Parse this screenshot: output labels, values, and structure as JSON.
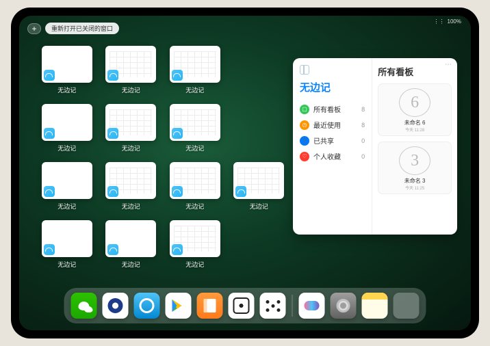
{
  "topbar": {
    "plus_label": "+",
    "reopen_label": "重新打开已关闭的窗口"
  },
  "statusbar": {
    "battery": "100%"
  },
  "grid": {
    "app_label": "无边记"
  },
  "panel": {
    "left_title": "无边记",
    "right_title": "所有看板",
    "filters": [
      {
        "label": "所有看板",
        "count": "8",
        "color": "#34c759"
      },
      {
        "label": "最近使用",
        "count": "8",
        "color": "#ff9500"
      },
      {
        "label": "已共享",
        "count": "0",
        "color": "#007aff"
      },
      {
        "label": "个人收藏",
        "count": "0",
        "color": "#ff3b30"
      }
    ],
    "boards": [
      {
        "glyph": "6",
        "name": "未命名 6",
        "sub": "今天 11:28"
      },
      {
        "glyph": "3",
        "name": "未命名 3",
        "sub": "今天 11:25"
      }
    ]
  },
  "dock": {
    "apps": [
      "wechat",
      "quark",
      "browser",
      "play",
      "books",
      "dice",
      "nodes"
    ],
    "recent": [
      "freeform",
      "settings",
      "notes",
      "folder"
    ]
  }
}
